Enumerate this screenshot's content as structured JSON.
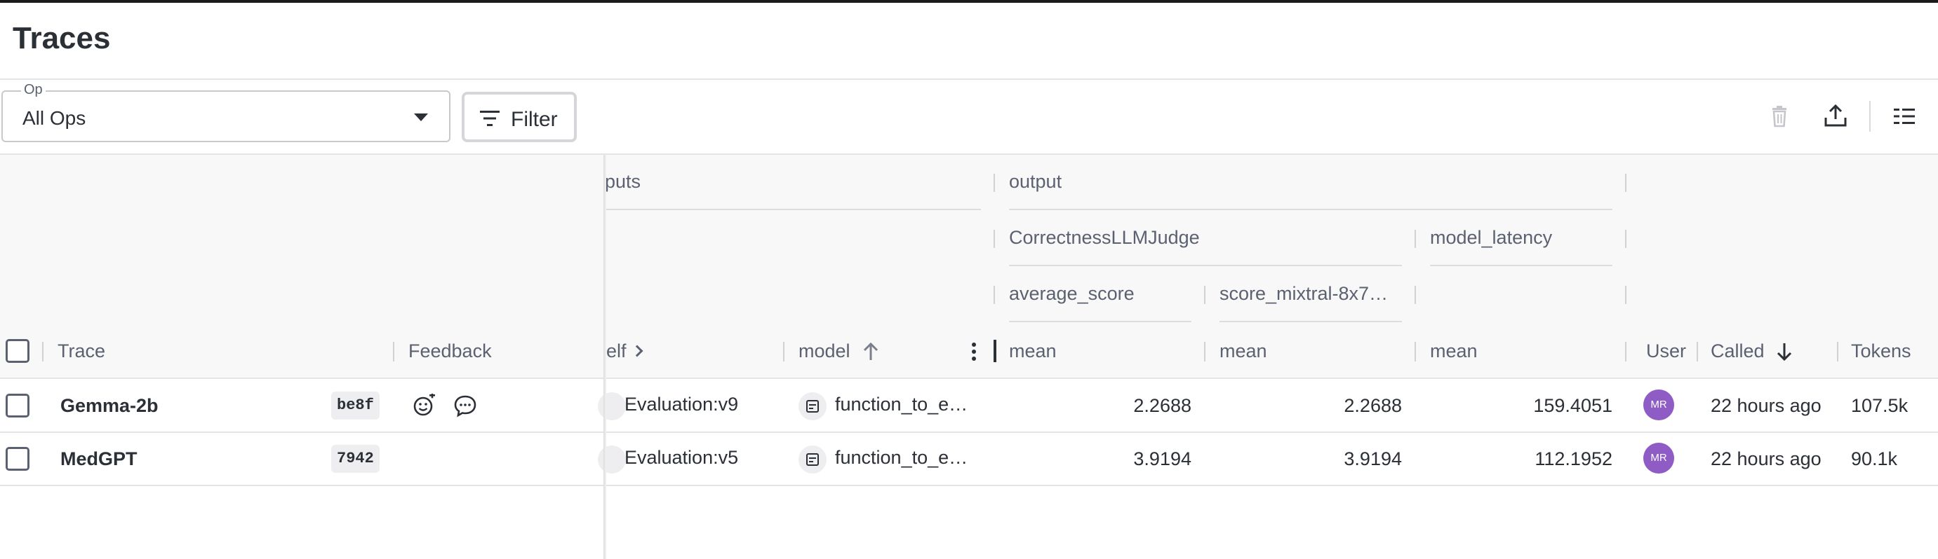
{
  "page": {
    "title": "Traces"
  },
  "toolbar": {
    "op_label": "Op",
    "op_value": "All Ops",
    "filter_label": "Filter",
    "icons": [
      "delete-icon",
      "export-icon",
      "columns-icon"
    ]
  },
  "header_groups": {
    "inputs": "puts",
    "output": "output",
    "correctness": "CorrectnessLLMJudge",
    "model_latency": "model_latency",
    "average_score": "average_score",
    "score_mixtral": "score_mixtral-8x7…"
  },
  "columns": {
    "trace": "Trace",
    "feedback": "Feedback",
    "self": "elf",
    "model": "model",
    "mean1": "mean",
    "mean2": "mean",
    "mean3": "mean",
    "user": "User",
    "called": "Called",
    "tokens": "Tokens"
  },
  "rows": [
    {
      "trace": "Gemma-2b",
      "id": "be8f",
      "self": "Evaluation:v9",
      "model": "function_to_e…",
      "avg_score": "2.2688",
      "score_mixtral": "2.2688",
      "latency": "159.4051",
      "user": "MR",
      "called": "22 hours ago",
      "tokens": "107.5k"
    },
    {
      "trace": "MedGPT",
      "id": "7942",
      "self": "Evaluation:v5",
      "model": "function_to_e…",
      "avg_score": "3.9194",
      "score_mixtral": "3.9194",
      "latency": "112.1952",
      "user": "MR",
      "called": "22 hours ago",
      "tokens": "90.1k"
    }
  ],
  "colors": {
    "avatar": "#8e5cc4",
    "header_bg": "#f8f8f8",
    "border": "#e3e4e7"
  }
}
